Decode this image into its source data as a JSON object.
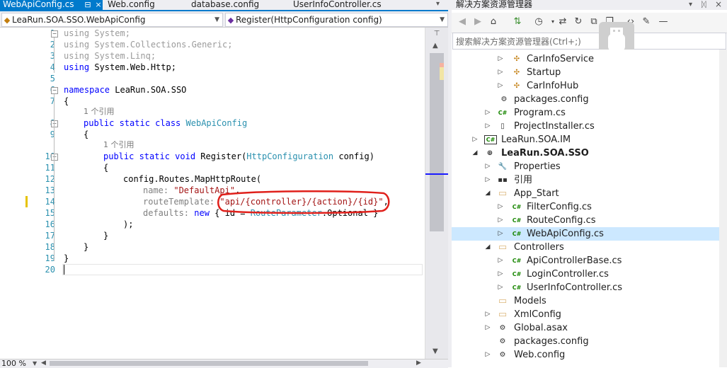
{
  "editor": {
    "tabs": [
      {
        "label": "WebApiConfig.cs",
        "active": true
      },
      {
        "label": "Web.config",
        "active": false
      },
      {
        "label": "database.config",
        "active": false
      },
      {
        "label": "UserInfoController.cs",
        "active": false
      }
    ],
    "close_glyph": "×",
    "pin_glyph": "⊟",
    "nav_left": "LeaRun.SOA.SSO.WebApiConfig",
    "nav_right": "Register(HttpConfiguration config)",
    "zoom": "100 %",
    "line_numbers": [
      "1",
      "2",
      "3",
      "4",
      "5",
      "6",
      "7",
      "8",
      "9",
      "10",
      "11",
      "12",
      "13",
      "14",
      "15",
      "16",
      "17",
      "18",
      "19",
      "20"
    ],
    "ref_hint": "1 个引用",
    "code": {
      "l1": "using System;",
      "l2": "using System.Collections.Generic;",
      "l3": "using System.Linq;",
      "l4_kw": "using",
      "l4_rest": " System.Web.Http;",
      "l6_kw": "namespace",
      "l6_rest": " LeaRun.SOA.SSO",
      "l7": "{",
      "l8_kw": "public static class",
      "l8_type": "WebApiConfig",
      "l9": "{",
      "l10_kw": "public static void",
      "l10_name": " Register(",
      "l10_type": "HttpConfiguration",
      "l10_rest": " config)",
      "l11": "{",
      "l12": "config.Routes.MapHttpRoute(",
      "l13_name": "name: ",
      "l13_str": "\"DefaultApi\"",
      "l13_tail": ",",
      "l14_name": "routeTemplate: ",
      "l14_str": "\"api/{controller}/{action}/{id}\"",
      "l14_tail": ",",
      "l15_name": "defaults: ",
      "l15_kw": "new",
      "l15_mid": " { id = ",
      "l15_type": "RouteParameter",
      "l15_rest": ".Optional }",
      "l16": ");",
      "l17": "}",
      "l18": "}",
      "l19": "}"
    }
  },
  "solution_explorer": {
    "title": "解决方案资源管理器",
    "search_placeholder": "搜索解决方案资源管理器(Ctrl+;)",
    "items": [
      {
        "label": "CarInfoService",
        "icon": "class-icon"
      },
      {
        "label": "Startup",
        "icon": "class-icon"
      },
      {
        "label": "CarInfoHub",
        "icon": "class-icon"
      },
      {
        "label": "packages.config",
        "icon": "config-file-icon"
      },
      {
        "label": "Program.cs",
        "icon": "csharp-file-icon"
      },
      {
        "label": "ProjectInstaller.cs",
        "icon": "file-icon"
      },
      {
        "label": "LeaRun.SOA.IM",
        "icon": "csharp-project-icon"
      },
      {
        "label": "LeaRun.SOA.SSO",
        "icon": "web-project-icon"
      },
      {
        "label": "Properties",
        "icon": "wrench-icon"
      },
      {
        "label": "引用",
        "icon": "references-icon"
      },
      {
        "label": "App_Start",
        "icon": "folder-icon"
      },
      {
        "label": "FilterConfig.cs",
        "icon": "csharp-file-icon"
      },
      {
        "label": "RouteConfig.cs",
        "icon": "csharp-file-icon"
      },
      {
        "label": "WebApiConfig.cs",
        "icon": "csharp-file-icon"
      },
      {
        "label": "Controllers",
        "icon": "folder-icon"
      },
      {
        "label": "ApiControllerBase.cs",
        "icon": "csharp-file-icon"
      },
      {
        "label": "LoginController.cs",
        "icon": "csharp-file-icon"
      },
      {
        "label": "UserInfoController.cs",
        "icon": "csharp-file-icon"
      },
      {
        "label": "Models",
        "icon": "folder-icon"
      },
      {
        "label": "XmlConfig",
        "icon": "folder-icon"
      },
      {
        "label": "Global.asax",
        "icon": "asax-file-icon"
      },
      {
        "label": "packages.config",
        "icon": "config-file-icon"
      },
      {
        "label": "Web.config",
        "icon": "config-file-icon"
      }
    ]
  },
  "colors": {
    "accent": "#007acc",
    "keyword": "#0000ff",
    "type": "#2b91af",
    "string": "#a31515",
    "annotation": "#e0201b",
    "selection": "#cce8ff"
  }
}
